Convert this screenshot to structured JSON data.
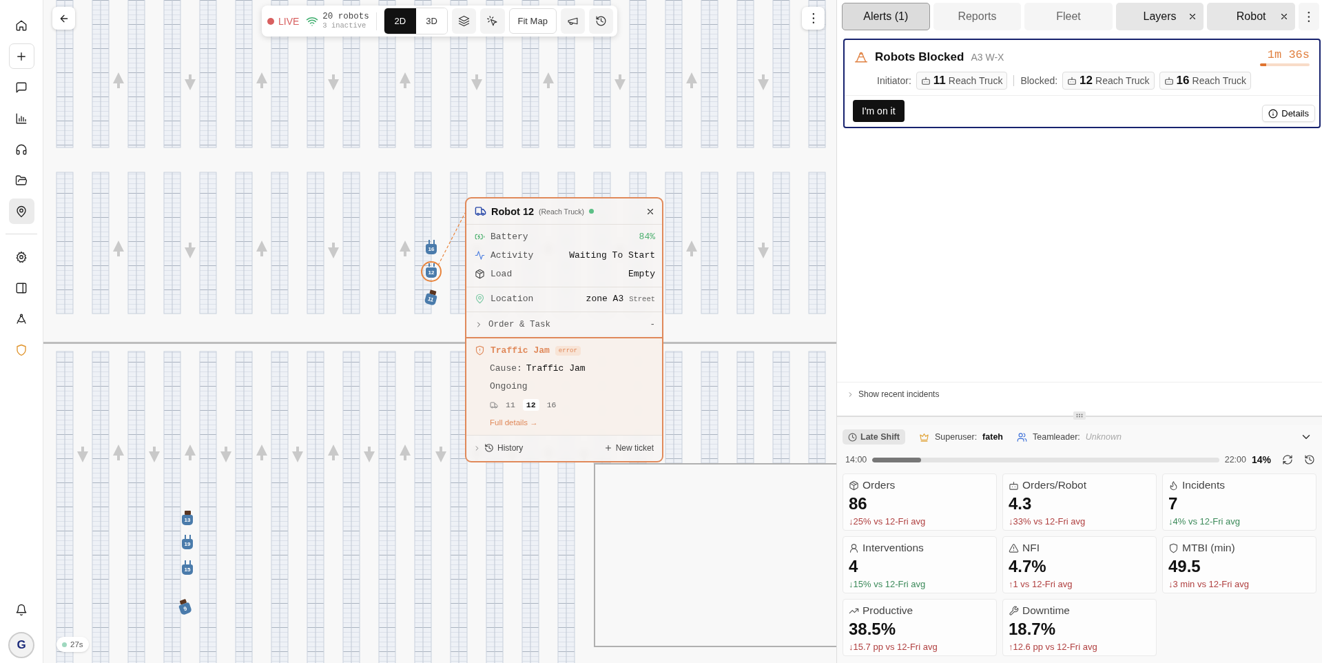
{
  "sidebar": {
    "top_items": [
      {
        "kind": "nav",
        "selected": false
      },
      {
        "kind": "action",
        "selected": false
      },
      {
        "kind": "nav",
        "selected": false
      },
      {
        "kind": "nav",
        "selected": false
      },
      {
        "kind": "nav",
        "selected": false
      },
      {
        "kind": "nav",
        "selected": false
      },
      {
        "kind": "nav",
        "selected": true
      }
    ],
    "tool_items": [
      {
        "kind": "nav",
        "selected": false
      },
      {
        "kind": "nav",
        "selected": false
      },
      {
        "kind": "nav",
        "selected": false
      },
      {
        "kind": "warning",
        "selected": false
      }
    ],
    "bottom_items": [
      {
        "selected": false
      }
    ],
    "avatar": "G"
  },
  "toolbar": {
    "live": "LIVE",
    "robots": "20 robots",
    "inactive": "3 inactive",
    "view_modes": [
      {
        "label": "2D",
        "selected": true
      },
      {
        "label": "3D",
        "selected": false
      }
    ],
    "fit_map": "Fit Map"
  },
  "map": {
    "robots": [
      {
        "label": "16",
        "loaded": false,
        "selected": false
      },
      {
        "label": "12",
        "loaded": false,
        "selected": true
      },
      {
        "label": "11",
        "loaded": true,
        "selected": false
      },
      {
        "label": "13",
        "loaded": true,
        "selected": false
      },
      {
        "label": "19",
        "loaded": false,
        "selected": false
      },
      {
        "label": "15",
        "loaded": false,
        "selected": false
      },
      {
        "label": "9",
        "loaded": true,
        "selected": false
      }
    ],
    "refresh_age": "27s"
  },
  "robot_popup": {
    "title": "Robot 12",
    "type": "(Reach Truck)",
    "online": true,
    "rows": [
      {
        "kind": "battery",
        "label": "Battery",
        "value": "84%"
      },
      {
        "kind": "activity",
        "label": "Activity",
        "value": "Waiting To Start"
      },
      {
        "kind": "load",
        "label": "Load",
        "value": "Empty"
      },
      {
        "kind": "location",
        "label": "Location",
        "value": "zone A3",
        "detail": "Street"
      }
    ],
    "order_task": {
      "label": "Order & Task",
      "value": "-",
      "expanded": false
    },
    "incident": {
      "title": "Traffic Jam",
      "severity": "error",
      "cause_label": "Cause:",
      "cause": "Traffic Jam",
      "status": "Ongoing",
      "robots": [
        {
          "label": "11",
          "selected": false
        },
        {
          "label": "12",
          "selected": true
        },
        {
          "label": "16",
          "selected": false
        }
      ],
      "link": "Full details →"
    },
    "history": {
      "label": "History",
      "expanded": false
    },
    "new_ticket": "New ticket"
  },
  "panel": {
    "tabs": [
      {
        "label": "Alerts (1)",
        "selected": true,
        "closable": false
      },
      {
        "label": "Reports",
        "selected": false,
        "closable": false
      },
      {
        "label": "Fleet",
        "selected": false,
        "closable": false
      },
      {
        "label": "Layers",
        "selected": false,
        "closable": true
      },
      {
        "label": "Robot",
        "selected": false,
        "closable": true
      }
    ],
    "alert": {
      "title": "Robots Blocked",
      "location": "A3 W-X",
      "timer": "1m 36s",
      "level": 0.12,
      "initiator_label": "Initiator:",
      "initiator": [
        {
          "number": "11",
          "type": "Reach Truck"
        }
      ],
      "blocked_label": "Blocked:",
      "blocked": [
        {
          "number": "12",
          "type": "Reach Truck"
        },
        {
          "number": "16",
          "type": "Reach Truck"
        }
      ],
      "action": "I'm on it",
      "details": "Details"
    },
    "recent_incidents": "Show recent incidents",
    "shift": {
      "name": "Late Shift",
      "superuser_label": "Superuser:",
      "superuser": "fateh",
      "teamleader_label": "Teamleader:",
      "teamleader": "Unknown",
      "start": "14:00",
      "end": "22:00",
      "level": 0.14,
      "percent": "14%"
    },
    "metrics": [
      {
        "label": "Orders",
        "value": "86",
        "delta": "↓25% vs 12-Fri avg",
        "good": false
      },
      {
        "label": "Orders/Robot",
        "value": "4.3",
        "delta": "↓33% vs 12-Fri avg",
        "good": false
      },
      {
        "label": "Incidents",
        "value": "7",
        "delta": "↓4% vs 12-Fri avg",
        "good": true
      },
      {
        "label": "Interventions",
        "value": "4",
        "delta": "↓15% vs 12-Fri avg",
        "good": true
      },
      {
        "label": "NFI",
        "value": "4.7%",
        "delta": "↑1 vs 12-Fri avg",
        "good": false
      },
      {
        "label": "MTBI (min)",
        "value": "49.5",
        "delta": "↓3 min vs 12-Fri avg",
        "good": false
      },
      {
        "label": "Productive",
        "value": "38.5%",
        "delta": "↓15.7 pp vs 12-Fri avg",
        "good": false
      },
      {
        "label": "Downtime",
        "value": "18.7%",
        "delta": "↑12.6 pp vs 12-Fri avg",
        "good": false
      }
    ]
  }
}
